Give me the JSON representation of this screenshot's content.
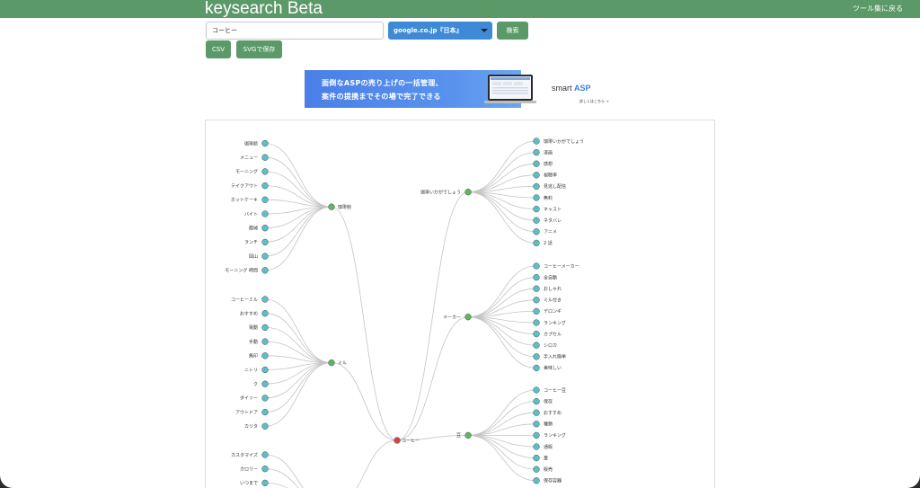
{
  "header": {
    "brand": "keysearch Beta",
    "back_link": "ツール集に戻る"
  },
  "search": {
    "value": "コーヒー",
    "domain": "google.co.jp『日本』",
    "search_label": "検索"
  },
  "export": {
    "csv_label": "CSV",
    "svg_label": "SVGで保存"
  },
  "ad": {
    "line1": "面倒なASPの売り上げの一括管理、",
    "line2": "案件の提携までその場で完了できる",
    "brand_prefix": "smart",
    "brand_suffix": "ASP",
    "more": "詳しくはこちら →"
  },
  "colors": {
    "header": "#5b9a68",
    "root_node": "#d9423c",
    "mid_node": "#5cb85c",
    "leaf_node": "#5bc0c4",
    "select": "#3f8ad6"
  },
  "tree": {
    "root": "コーヒー",
    "left": [
      {
        "label": "珈琲館",
        "children": [
          "珈琲館",
          "メニュー",
          "モーニング",
          "テイクアウト",
          "ホットケーキ",
          "バイト",
          "都城",
          "ランチ",
          "岡山",
          "モーニング 時間"
        ]
      },
      {
        "label": "ミル",
        "children": [
          "コーヒーミル",
          "おすすめ",
          "電動",
          "手動",
          "無印",
          "ニトリ",
          "ク",
          "ダイソー",
          "アウトドア",
          "カリタ"
        ]
      },
      {
        "label": "",
        "children": [
          "カスタマイズ",
          "カロリー",
          "いつまで"
        ]
      }
    ],
    "right": [
      {
        "label": "珈琲いかがでしょう",
        "children": [
          "珈琲いかがでしょう",
          "漫画",
          "感想",
          "視聴率",
          "見逃し配信",
          "無料",
          "キャスト",
          "ネタバレ",
          "アニメ",
          "2 話"
        ]
      },
      {
        "label": "メーカー",
        "children": [
          "コーヒーメーカー",
          "全自動",
          "おしゃれ",
          "ミル付き",
          "デロンギ",
          "ランキング",
          "カプセル",
          "シロカ",
          "手入れ簡単",
          "美味しい"
        ]
      },
      {
        "label": "豆",
        "children": [
          "コーヒー豆",
          "保存",
          "おすすめ",
          "種類",
          "ランキング",
          "通販",
          "量",
          "販売",
          "保存容器"
        ]
      }
    ]
  }
}
